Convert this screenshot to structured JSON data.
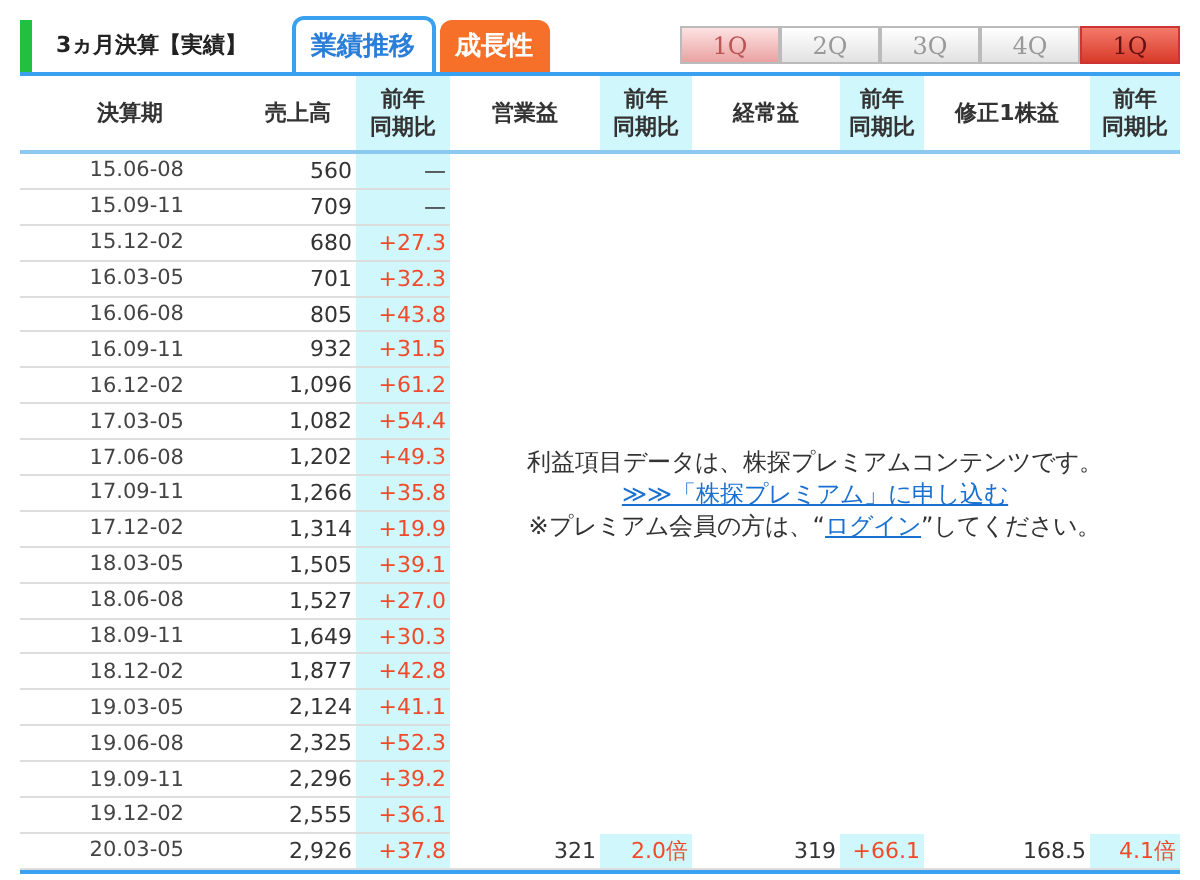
{
  "header": {
    "title": "3ヵ月決算【実績】",
    "tabs": [
      {
        "label": "業績推移",
        "selected": true
      },
      {
        "label": "成長性",
        "selected": false
      }
    ],
    "quarters": [
      {
        "label": "1Q",
        "selected": false,
        "kind": "light"
      },
      {
        "label": "2Q",
        "selected": false,
        "kind": "plain"
      },
      {
        "label": "3Q",
        "selected": false,
        "kind": "plain"
      },
      {
        "label": "4Q",
        "selected": false,
        "kind": "plain"
      },
      {
        "label": "1Q",
        "selected": true,
        "kind": "plain"
      }
    ]
  },
  "table": {
    "columns": [
      {
        "label": "決算期",
        "kind": "period"
      },
      {
        "label": "売上高",
        "kind": "value"
      },
      {
        "label": "前年同期比",
        "kind": "yoy"
      },
      {
        "label": "営業益",
        "kind": "value"
      },
      {
        "label": "前年同期比",
        "kind": "yoy"
      },
      {
        "label": "経常益",
        "kind": "value"
      },
      {
        "label": "前年同期比",
        "kind": "yoy"
      },
      {
        "label": "修正1株益",
        "kind": "value"
      },
      {
        "label": "前年同期比",
        "kind": "yoy"
      }
    ],
    "rows": [
      {
        "positive": false,
        "cells": [
          "15.06-08",
          "560",
          "—"
        ]
      },
      {
        "positive": false,
        "cells": [
          "15.09-11",
          "709",
          "—"
        ]
      },
      {
        "positive": true,
        "cells": [
          "15.12-02",
          "680",
          "+27.3"
        ]
      },
      {
        "positive": true,
        "cells": [
          "16.03-05",
          "701",
          "+32.3"
        ]
      },
      {
        "positive": true,
        "cells": [
          "16.06-08",
          "805",
          "+43.8"
        ]
      },
      {
        "positive": true,
        "cells": [
          "16.09-11",
          "932",
          "+31.5"
        ]
      },
      {
        "positive": true,
        "cells": [
          "16.12-02",
          "1,096",
          "+61.2"
        ]
      },
      {
        "positive": true,
        "cells": [
          "17.03-05",
          "1,082",
          "+54.4"
        ]
      },
      {
        "positive": true,
        "cells": [
          "17.06-08",
          "1,202",
          "+49.3"
        ]
      },
      {
        "positive": true,
        "cells": [
          "17.09-11",
          "1,266",
          "+35.8"
        ]
      },
      {
        "positive": true,
        "cells": [
          "17.12-02",
          "1,314",
          "+19.9"
        ]
      },
      {
        "positive": true,
        "cells": [
          "18.03-05",
          "1,505",
          "+39.1"
        ]
      },
      {
        "positive": true,
        "cells": [
          "18.06-08",
          "1,527",
          "+27.0"
        ]
      },
      {
        "positive": true,
        "cells": [
          "18.09-11",
          "1,649",
          "+30.3"
        ]
      },
      {
        "positive": true,
        "cells": [
          "18.12-02",
          "1,877",
          "+42.8"
        ]
      },
      {
        "positive": true,
        "cells": [
          "19.03-05",
          "2,124",
          "+41.1"
        ]
      },
      {
        "positive": true,
        "cells": [
          "19.06-08",
          "2,325",
          "+52.3"
        ]
      },
      {
        "positive": true,
        "cells": [
          "19.09-11",
          "2,296",
          "+39.2"
        ]
      },
      {
        "positive": true,
        "cells": [
          "19.12-02",
          "2,555",
          "+36.1"
        ]
      },
      {
        "positive": true,
        "cells": [
          "20.03-05",
          "2,926",
          "+37.8",
          "321",
          "2.0倍",
          "319",
          "+66.1",
          "168.5",
          "4.1倍"
        ]
      }
    ],
    "notice": {
      "text": "利益項目データは、株探プレミアムコンテンツです。",
      "signup_link": "≫≫「株探プレミアム」に申し込む",
      "login_prefix": "※プレミアム会員の方は、“",
      "login_link": "ログイン",
      "login_suffix": "”してください。"
    }
  }
}
